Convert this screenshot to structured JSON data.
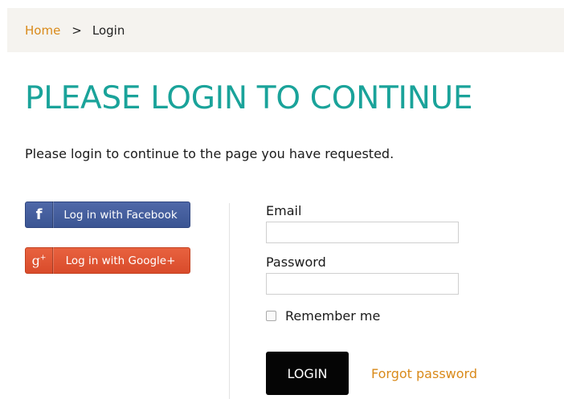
{
  "breadcrumb": {
    "home": "Home",
    "separator": ">",
    "current": "Login"
  },
  "heading": "PLEASE LOGIN TO CONTINUE",
  "intro": "Please login to continue to the page you have requested.",
  "social": {
    "facebook": {
      "label": "Log in with Facebook",
      "icon": "facebook-icon",
      "glyph": "f",
      "color": "#3b5593"
    },
    "google": {
      "label": "Log in with Google+",
      "icon": "google-plus-icon",
      "glyph": "g",
      "glyph_sup": "+",
      "color": "#d94b2b"
    }
  },
  "form": {
    "email_label": "Email",
    "email_value": "",
    "password_label": "Password",
    "password_value": "",
    "remember_label": "Remember me",
    "remember_checked": false,
    "login_label": "LOGIN",
    "forgot_label": "Forgot password"
  },
  "colors": {
    "accent": "#1aa39a",
    "link": "#d98a1a",
    "breadcrumb_bg": "#f5f3ef",
    "login_button": "#050505"
  }
}
